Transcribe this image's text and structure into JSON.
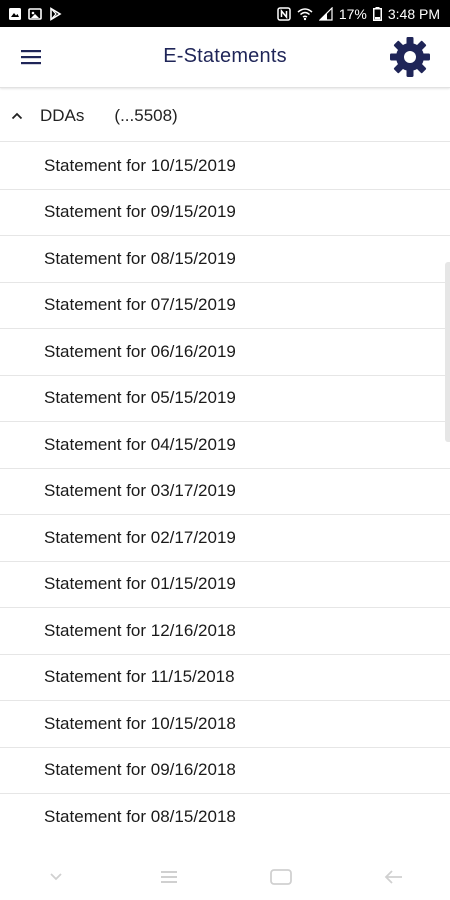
{
  "status_bar": {
    "battery_percent": "17%",
    "time": "3:48 PM",
    "icons": [
      "gallery-icon",
      "image-icon",
      "play-store-icon",
      "nfc-icon",
      "wifi-icon",
      "signal-icon",
      "battery-icon"
    ]
  },
  "app_bar": {
    "title": "E-Statements",
    "menu_icon": "hamburger-menu-icon",
    "settings_icon": "gear-icon",
    "accent_color": "#1f2558"
  },
  "section": {
    "label": "DDAs",
    "account": "(...5508)",
    "expanded": true
  },
  "statements": [
    {
      "label": "Statement for 10/15/2019"
    },
    {
      "label": "Statement for 09/15/2019"
    },
    {
      "label": "Statement for 08/15/2019"
    },
    {
      "label": "Statement for 07/15/2019"
    },
    {
      "label": "Statement for 06/16/2019"
    },
    {
      "label": "Statement for 05/15/2019"
    },
    {
      "label": "Statement for 04/15/2019"
    },
    {
      "label": "Statement for 03/17/2019"
    },
    {
      "label": "Statement for 02/17/2019"
    },
    {
      "label": "Statement for 01/15/2019"
    },
    {
      "label": "Statement for 12/16/2018"
    },
    {
      "label": "Statement for 11/15/2018"
    },
    {
      "label": "Statement for 10/15/2018"
    },
    {
      "label": "Statement for 09/16/2018"
    },
    {
      "label": "Statement for 08/15/2018"
    }
  ]
}
